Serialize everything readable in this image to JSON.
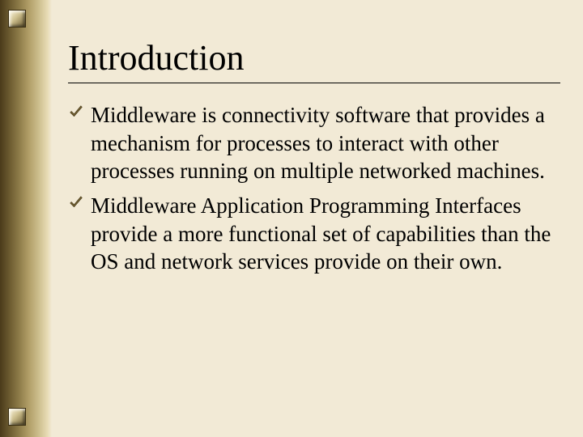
{
  "title": "Introduction",
  "bullets": [
    {
      "text": "Middleware is connectivity software that provides a mechanism for processes to interact with other processes running on multiple networked machines."
    },
    {
      "text": "Middleware Application Programming Interfaces provide a more functional set of capabilities than the OS and network services provide on their own."
    }
  ]
}
